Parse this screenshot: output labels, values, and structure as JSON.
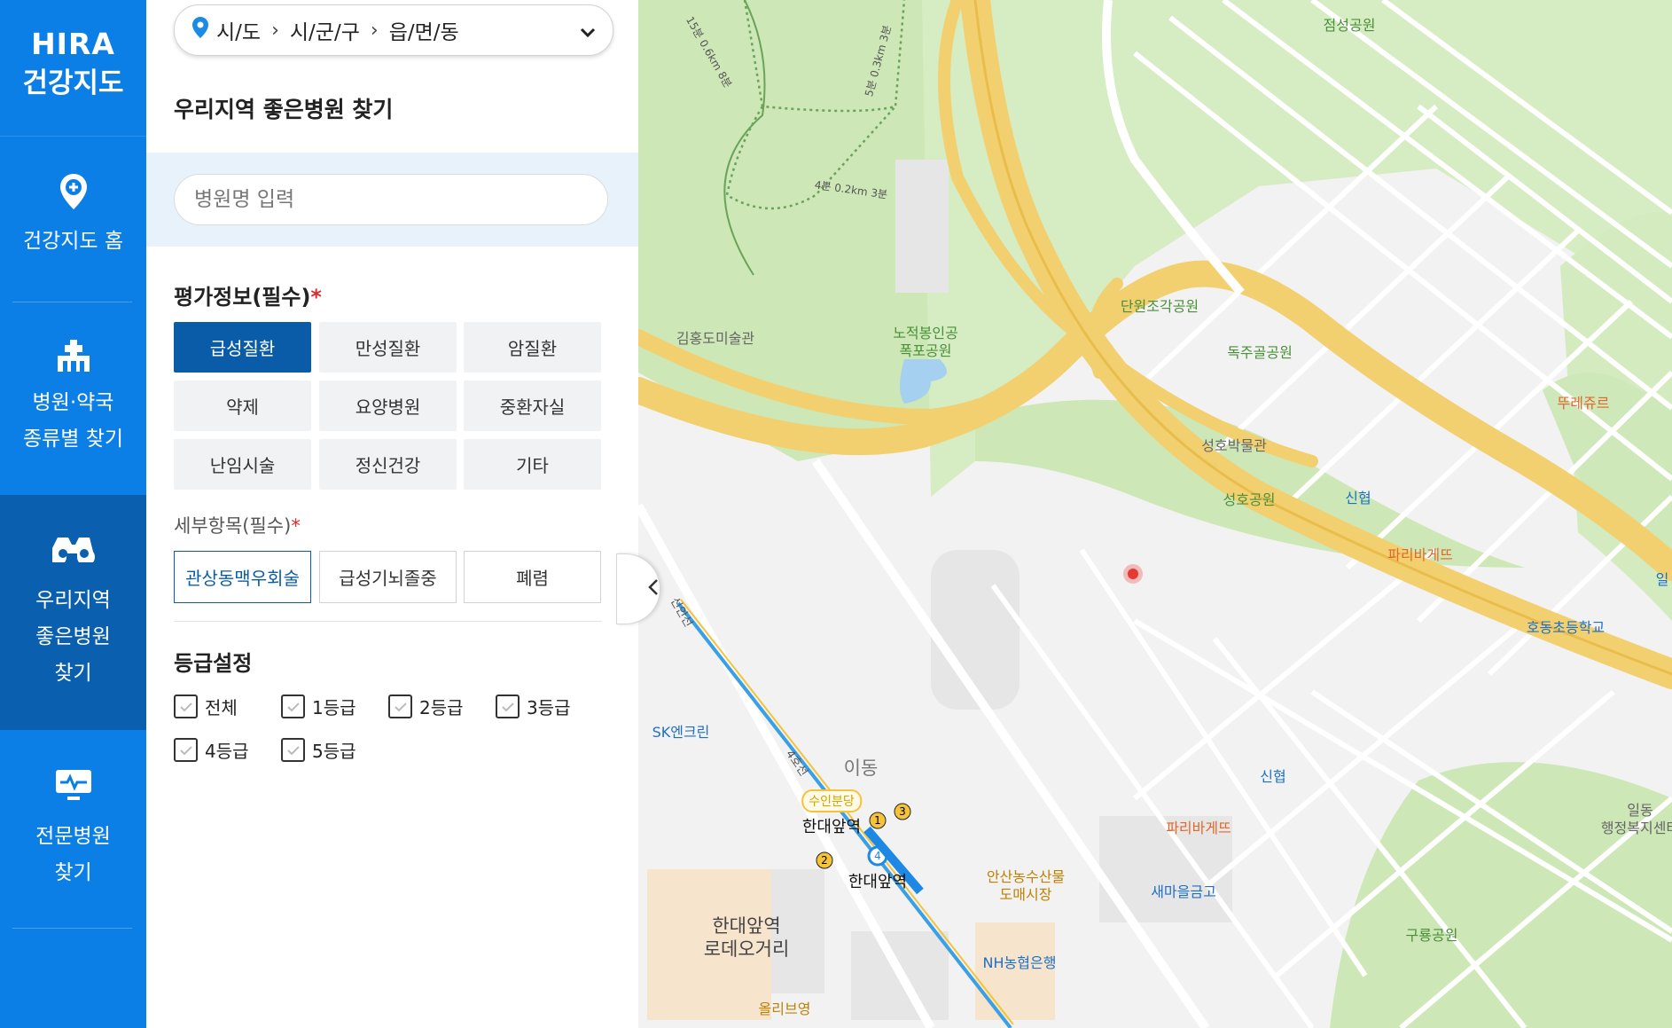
{
  "nav": {
    "logo_line1": "HIRA",
    "logo_line2": "건강지도",
    "items": [
      {
        "lines": [
          "건강지도 홈"
        ],
        "icon": "location-plus-icon"
      },
      {
        "lines": [
          "병원·약국",
          "종류별 찾기"
        ],
        "icon": "hospital-icon"
      },
      {
        "lines": [
          "우리지역",
          "좋은병원",
          "찾기"
        ],
        "icon": "binoculars-icon",
        "active": true
      },
      {
        "lines": [
          "전문병원",
          "찾기"
        ],
        "icon": "monitor-pulse-icon"
      }
    ]
  },
  "region": {
    "sido": "시/도",
    "sigungu": "시/군/구",
    "dong": "읍/면/동"
  },
  "panel": {
    "title": "우리지역 좋은병원 찾기",
    "search_placeholder": "병원명 입력",
    "eval_heading": "평가정보(필수)",
    "required_mark": "*",
    "eval_items": [
      "급성질환",
      "만성질환",
      "암질환",
      "약제",
      "요양병원",
      "중환자실",
      "난임시술",
      "정신건강",
      "기타"
    ],
    "eval_selected": "급성질환",
    "detail_heading": "세부항목(필수)",
    "detail_items": [
      "관상동맥우회술",
      "급성기뇌졸중",
      "폐렴"
    ],
    "detail_selected": "관상동맥우회술",
    "grade_heading": "등급설정",
    "grade_items": [
      "전체",
      "1등급",
      "2등급",
      "3등급",
      "4등급",
      "5등급"
    ]
  },
  "map": {
    "labels": {
      "jeomseong": "점성공원",
      "kimhongdo": "김홍도미술관",
      "nojeok1": "노적봉인공",
      "nojeok2": "폭포공원",
      "danwon": "단원조각공원",
      "dokju": "독주골공원",
      "tous": "뚜레쥬르",
      "seongho_museum": "성호박물관",
      "seongho_park": "성호공원",
      "shinhyup1": "신협",
      "paris1": "파리바게뜨",
      "hodong": "호동초등학교",
      "il_edge": "일",
      "sk": "SK엔크린",
      "idong": "이동",
      "suin": "수인분당",
      "hanyang1": "한대앞역",
      "hanyang2": "한대앞역",
      "line4": "4호선",
      "shinhyup2": "신협",
      "paris2": "파리바게뜨",
      "ansan_market1": "안산농수산물",
      "ansan_market2": "도매시장",
      "saemaul": "새마을금고",
      "rodeo1": "한대앞역",
      "rodeo2": "로데오거리",
      "nh": "NH농협은행",
      "olive": "올리브영",
      "guryong": "구룡공원",
      "ildong1": "일동",
      "ildong2": "행정복지센터",
      "exit1": "1",
      "exit2": "2",
      "exit3": "3",
      "exit4": "4",
      "trail1": "5분 0.3km 3분",
      "trail2": "4분 0.2km 3분",
      "trail3": "15분 0.6km 8분",
      "rail_label": "신안선"
    },
    "colors": {
      "park": "#cde7b6",
      "road_major": "#f5d67a",
      "urban": "#f2f2f2"
    }
  }
}
